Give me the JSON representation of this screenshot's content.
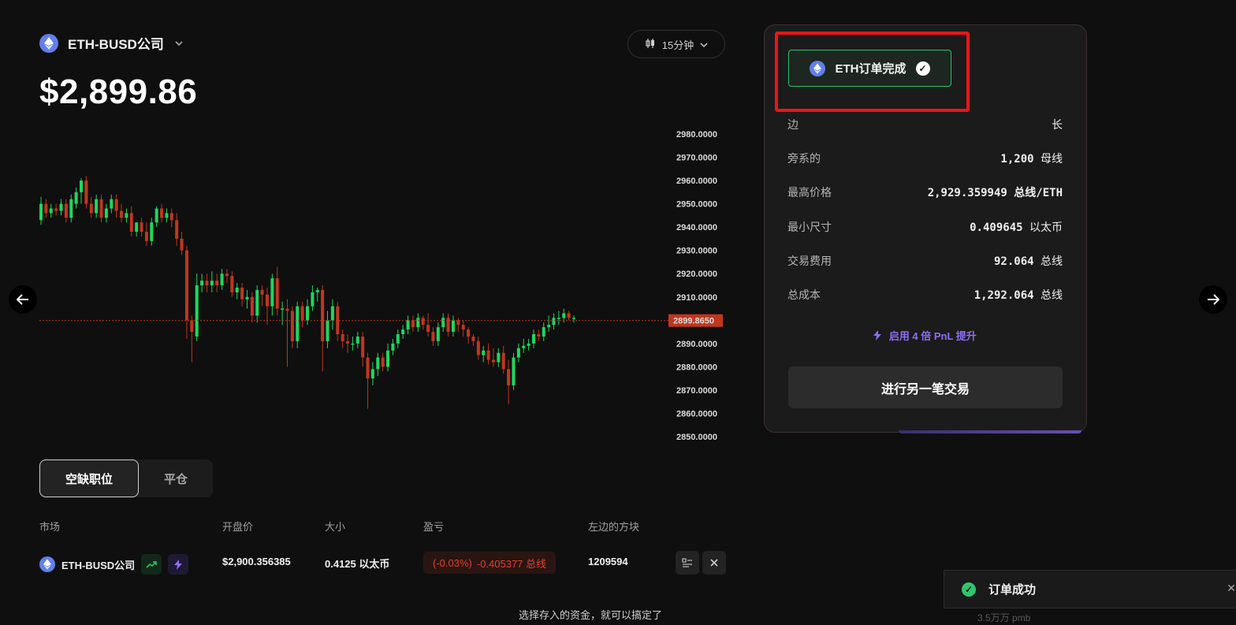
{
  "header": {
    "pair": "ETH-BUSD公司",
    "price": "$2,899.86",
    "interval": "15分钟"
  },
  "chart_data": {
    "type": "candlestick",
    "y_ticks": [
      "2980.0000",
      "2970.0000",
      "2960.0000",
      "2950.0000",
      "2940.0000",
      "2930.0000",
      "2920.0000",
      "2910.0000",
      "2900.0000",
      "2890.0000",
      "2880.0000",
      "2870.0000",
      "2860.0000",
      "2850.0000"
    ],
    "ylim": [
      2850,
      2980
    ],
    "current_price": 2899.865,
    "current_price_label": "2899.8650",
    "up_color": "#1ed760",
    "down_color": "#c0361f",
    "closes": [
      2950,
      2946,
      2948,
      2947,
      2950,
      2944,
      2952,
      2955,
      2960,
      2950,
      2946,
      2952,
      2944,
      2948,
      2952,
      2947,
      2944,
      2946,
      2938,
      2942,
      2938,
      2934,
      2942,
      2948,
      2944,
      2946,
      2943,
      2935,
      2930,
      2900,
      2895,
      2915,
      2917,
      2915,
      2917,
      2915,
      2920,
      2919,
      2912,
      2914,
      2909,
      2910,
      2902,
      2913,
      2911,
      2906,
      2918,
      2905,
      2905,
      2904,
      2891,
      2906,
      2900,
      2906,
      2912,
      2913,
      2891,
      2900,
      2906,
      2894,
      2891,
      2890,
      2890,
      2893,
      2884,
      2875,
      2879,
      2884,
      2880,
      2887,
      2890,
      2894,
      2896,
      2900,
      2897,
      2901,
      2898,
      2895,
      2891,
      2897,
      2901,
      2895,
      2900,
      2898,
      2896,
      2893,
      2891,
      2885,
      2887,
      2883,
      2882,
      2886,
      2879,
      2872,
      2884,
      2888,
      2889,
      2890,
      2894,
      2893,
      2897,
      2898,
      2901,
      2901,
      2903,
      2901,
      2901
    ],
    "opens": [
      2943,
      2950,
      2946,
      2948,
      2947,
      2950,
      2944,
      2950,
      2955,
      2960,
      2950,
      2946,
      2952,
      2944,
      2948,
      2952,
      2947,
      2944,
      2946,
      2938,
      2942,
      2938,
      2934,
      2942,
      2948,
      2944,
      2946,
      2943,
      2935,
      2930,
      2900,
      2893,
      2915,
      2917,
      2915,
      2917,
      2915,
      2920,
      2919,
      2912,
      2914,
      2909,
      2910,
      2902,
      2913,
      2911,
      2906,
      2918,
      2905,
      2905,
      2904,
      2891,
      2906,
      2900,
      2906,
      2912,
      2913,
      2891,
      2900,
      2906,
      2894,
      2891,
      2890,
      2890,
      2893,
      2884,
      2875,
      2879,
      2884,
      2880,
      2887,
      2890,
      2894,
      2896,
      2900,
      2897,
      2901,
      2898,
      2895,
      2891,
      2897,
      2901,
      2895,
      2900,
      2898,
      2896,
      2893,
      2891,
      2885,
      2887,
      2883,
      2882,
      2886,
      2879,
      2872,
      2884,
      2888,
      2889,
      2890,
      2894,
      2893,
      2897,
      2898,
      2901,
      2901,
      2903,
      2901
    ],
    "highs": [
      2953,
      2952,
      2950,
      2950,
      2952,
      2952,
      2954,
      2957,
      2961,
      2962,
      2953,
      2954,
      2954,
      2950,
      2954,
      2954,
      2950,
      2948,
      2949,
      2942,
      2944,
      2942,
      2944,
      2949,
      2950,
      2948,
      2948,
      2946,
      2938,
      2932,
      2902,
      2920,
      2920,
      2920,
      2921,
      2920,
      2922,
      2922,
      2921,
      2916,
      2916,
      2913,
      2912,
      2915,
      2915,
      2914,
      2920,
      2923,
      2908,
      2909,
      2906,
      2908,
      2908,
      2909,
      2915,
      2914,
      2915,
      2904,
      2909,
      2908,
      2896,
      2894,
      2893,
      2895,
      2895,
      2886,
      2882,
      2886,
      2886,
      2890,
      2892,
      2896,
      2898,
      2902,
      2902,
      2903,
      2902,
      2903,
      2897,
      2899,
      2903,
      2903,
      2902,
      2901,
      2900,
      2897,
      2894,
      2893,
      2889,
      2890,
      2888,
      2888,
      2889,
      2883,
      2886,
      2890,
      2892,
      2892,
      2896,
      2896,
      2899,
      2902,
      2903,
      2904,
      2905,
      2904,
      2902
    ],
    "lows": [
      2941,
      2944,
      2944,
      2945,
      2945,
      2942,
      2942,
      2948,
      2950,
      2948,
      2944,
      2944,
      2942,
      2942,
      2946,
      2944,
      2942,
      2942,
      2936,
      2936,
      2936,
      2932,
      2932,
      2940,
      2942,
      2942,
      2940,
      2932,
      2928,
      2892,
      2882,
      2891,
      2912,
      2912,
      2912,
      2912,
      2913,
      2916,
      2910,
      2909,
      2906,
      2905,
      2899,
      2899,
      2906,
      2898,
      2902,
      2902,
      2898,
      2880,
      2888,
      2888,
      2897,
      2898,
      2904,
      2908,
      2878,
      2888,
      2896,
      2891,
      2888,
      2886,
      2887,
      2888,
      2880,
      2862,
      2872,
      2876,
      2878,
      2878,
      2885,
      2888,
      2892,
      2894,
      2895,
      2895,
      2896,
      2893,
      2889,
      2889,
      2895,
      2893,
      2893,
      2895,
      2893,
      2890,
      2889,
      2883,
      2882,
      2881,
      2880,
      2880,
      2877,
      2864,
      2870,
      2882,
      2886,
      2887,
      2888,
      2891,
      2891,
      2895,
      2896,
      2898,
      2899,
      2900,
      2899
    ]
  },
  "tabs": {
    "positions": "空缺职位",
    "close": "平仓"
  },
  "table": {
    "headers": {
      "market": "市场",
      "open_price": "开盘价",
      "size": "大小",
      "pnl": "盈亏",
      "blocks_left": "左边的方块"
    },
    "row": {
      "market": "ETH-BUSD公司",
      "open_price": "$2,900.356385",
      "size": "0.4125 以太币",
      "pnl_pct": "(-0.03%)",
      "pnl_value": "-0.405377 总线",
      "blocks_left": "1209594"
    }
  },
  "panel": {
    "status": "ETH订单完成",
    "rows": [
      {
        "label": "边",
        "value": "",
        "unit": "长"
      },
      {
        "label": "旁系的",
        "value": "1,200",
        "unit": "母线"
      },
      {
        "label": "最高价格",
        "value": "2,929.359949",
        "unit": "总线/ETH"
      },
      {
        "label": "最小尺寸",
        "value": "0.409645",
        "unit": "以太币"
      },
      {
        "label": "交易费用",
        "value": "92.064",
        "unit": "总线"
      },
      {
        "label": "总成本",
        "value": "1,292.064",
        "unit": "总线"
      }
    ],
    "boost": "启用 4 倍 PnL 提升",
    "new_trade": "进行另一笔交易"
  },
  "toast": {
    "text": "订单成功",
    "ghost": "3.5万万 pmb"
  },
  "footer_note": "选择存入的资金，就可以搞定了"
}
